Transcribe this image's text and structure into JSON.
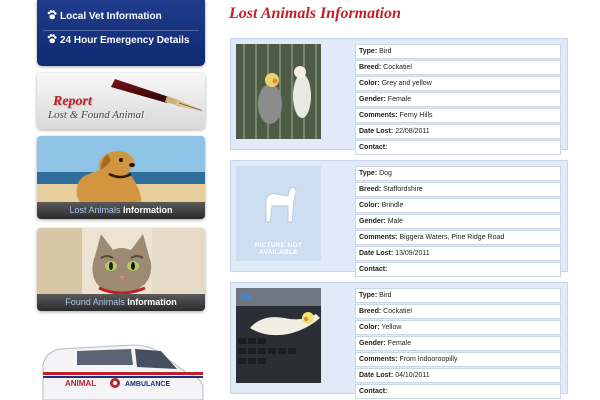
{
  "sidebar": {
    "nav": [
      {
        "label": "Local Vet Information",
        "icon": "paw-icon"
      },
      {
        "label": "24 Hour Emergency Details",
        "icon": "paw-icon"
      }
    ],
    "report": {
      "title": "Report",
      "subtitle": "Lost & Found Animal",
      "icon": "fountain-pen-icon"
    },
    "lost_promo": {
      "highlight": "Lost Animals",
      "rest": "Information",
      "image": "golden-retriever-photo"
    },
    "found_promo": {
      "highlight": "Found Animals",
      "rest": "Information",
      "image": "kitten-photo"
    },
    "van": {
      "brand_left": "ANIMAL",
      "brand_right": "AMBULANCE",
      "image": "animal-ambulance-van-photo"
    }
  },
  "main": {
    "title": "Lost Animals Information",
    "no_picture": "PICTURE NOT AVAILABLE",
    "listings": [
      {
        "photo": "cockatiel-grey-photo",
        "fields": [
          {
            "label": "Type:",
            "value": "Bird"
          },
          {
            "label": "Breed:",
            "value": "Cockatiel"
          },
          {
            "label": "Color:",
            "value": "Grey and yellow"
          },
          {
            "label": "Gender:",
            "value": "Female"
          },
          {
            "label": "Comments:",
            "value": "Ferny Hills"
          },
          {
            "label": "Date Lost:",
            "value": "22/08/2011"
          },
          {
            "label": "Contact:",
            "value": ""
          }
        ]
      },
      {
        "photo": "picture-not-available",
        "fields": [
          {
            "label": "Type:",
            "value": "Dog"
          },
          {
            "label": "Breed:",
            "value": "Staffordshire"
          },
          {
            "label": "Color:",
            "value": "Brindle"
          },
          {
            "label": "Gender:",
            "value": "Male"
          },
          {
            "label": "Comments:",
            "value": "Biggera Waters, Pine Ridge Road"
          },
          {
            "label": "Date Lost:",
            "value": "13/09/2011"
          },
          {
            "label": "Contact:",
            "value": ""
          }
        ]
      },
      {
        "photo": "cockatiel-yellow-photo",
        "fields": [
          {
            "label": "Type:",
            "value": "Bird"
          },
          {
            "label": "Breed:",
            "value": "Cockatiel"
          },
          {
            "label": "Color:",
            "value": "Yellow"
          },
          {
            "label": "Gender:",
            "value": "Female"
          },
          {
            "label": "Comments:",
            "value": "From Indooroopilly"
          },
          {
            "label": "Date Lost:",
            "value": "04/10/2011"
          },
          {
            "label": "Contact:",
            "value": ""
          }
        ]
      }
    ]
  },
  "colors": {
    "nav_blue": "#1a3580",
    "title_red": "#c0202a",
    "card_bg": "#e0eaf8"
  }
}
